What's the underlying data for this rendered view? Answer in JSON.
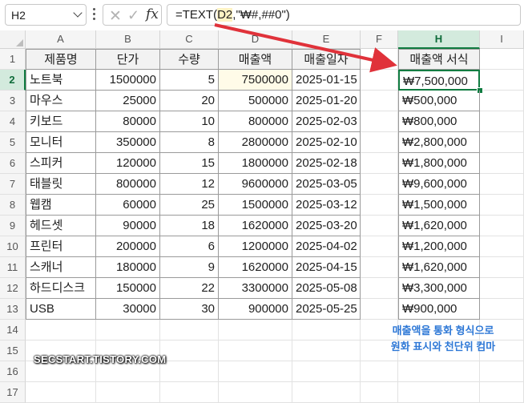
{
  "formula_bar": {
    "name_box": "H2",
    "formula_prefix": "=TEXT(",
    "formula_ref": "D2",
    "formula_suffix": ",\"₩#,##0\")",
    "cancel_icon": "x-icon",
    "enter_icon": "check-icon",
    "fx_label": "fx"
  },
  "columns": [
    "A",
    "B",
    "C",
    "D",
    "E",
    "F",
    "H",
    "I"
  ],
  "rows": [
    "1",
    "2",
    "3",
    "4",
    "5",
    "6",
    "7",
    "8",
    "9",
    "10",
    "11",
    "12",
    "13",
    "14",
    "15",
    "16",
    "17"
  ],
  "table": {
    "headers": {
      "A": "제품명",
      "B": "단가",
      "C": "수량",
      "D": "매출액",
      "E": "매출일자",
      "H": "매출액 서식"
    },
    "records": [
      {
        "A": "노트북",
        "B": "1500000",
        "C": "5",
        "D": "7500000",
        "E": "2025-01-15",
        "H": "₩7,500,000"
      },
      {
        "A": "마우스",
        "B": "25000",
        "C": "20",
        "D": "500000",
        "E": "2025-01-20",
        "H": "₩500,000"
      },
      {
        "A": "키보드",
        "B": "80000",
        "C": "10",
        "D": "800000",
        "E": "2025-02-03",
        "H": "₩800,000"
      },
      {
        "A": "모니터",
        "B": "350000",
        "C": "8",
        "D": "2800000",
        "E": "2025-02-10",
        "H": "₩2,800,000"
      },
      {
        "A": "스피커",
        "B": "120000",
        "C": "15",
        "D": "1800000",
        "E": "2025-02-18",
        "H": "₩1,800,000"
      },
      {
        "A": "태블릿",
        "B": "800000",
        "C": "12",
        "D": "9600000",
        "E": "2025-03-05",
        "H": "₩9,600,000"
      },
      {
        "A": "웹캠",
        "B": "60000",
        "C": "25",
        "D": "1500000",
        "E": "2025-03-12",
        "H": "₩1,500,000"
      },
      {
        "A": "헤드셋",
        "B": "90000",
        "C": "18",
        "D": "1620000",
        "E": "2025-03-20",
        "H": "₩1,620,000"
      },
      {
        "A": "프린터",
        "B": "200000",
        "C": "6",
        "D": "1200000",
        "E": "2025-04-02",
        "H": "₩1,200,000"
      },
      {
        "A": "스캐너",
        "B": "180000",
        "C": "9",
        "D": "1620000",
        "E": "2025-04-15",
        "H": "₩1,620,000"
      },
      {
        "A": "하드디스크",
        "B": "150000",
        "C": "22",
        "D": "3300000",
        "E": "2025-05-08",
        "H": "₩3,300,000"
      },
      {
        "A": "USB",
        "B": "30000",
        "C": "30",
        "D": "900000",
        "E": "2025-05-25",
        "H": "₩900,000"
      }
    ]
  },
  "note": {
    "line1": "매출액을 통화 형식으로",
    "line2": "원화 표시와 천단위 컴마"
  },
  "watermark": "SECSTART.TISTORY.COM",
  "colors": {
    "accent": "#107c41",
    "annotation": "#2e78d6",
    "arrow": "#e0323a"
  }
}
